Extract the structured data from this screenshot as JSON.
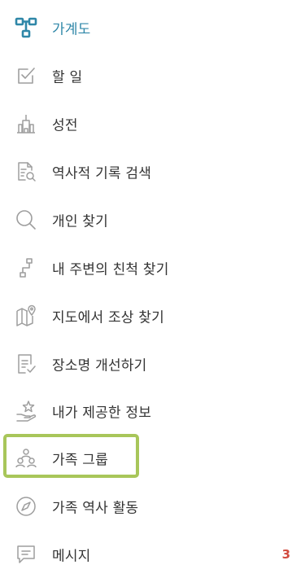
{
  "menu": {
    "items": [
      {
        "label": "가계도",
        "icon": "tree-icon",
        "active": true,
        "badge": ""
      },
      {
        "label": "할 일",
        "icon": "checklist-icon",
        "active": false,
        "badge": ""
      },
      {
        "label": "성전",
        "icon": "temple-icon",
        "active": false,
        "badge": ""
      },
      {
        "label": "역사적 기록 검색",
        "icon": "records-search-icon",
        "active": false,
        "badge": ""
      },
      {
        "label": "개인 찾기",
        "icon": "search-icon",
        "active": false,
        "badge": ""
      },
      {
        "label": "내 주변의 친척 찾기",
        "icon": "relatives-around-me-icon",
        "active": false,
        "badge": ""
      },
      {
        "label": "지도에서 조상 찾기",
        "icon": "map-pin-icon",
        "active": false,
        "badge": ""
      },
      {
        "label": "장소명 개선하기",
        "icon": "document-check-icon",
        "active": false,
        "badge": ""
      },
      {
        "label": "내가 제공한 정보",
        "icon": "hand-star-icon",
        "active": false,
        "badge": ""
      },
      {
        "label": "가족 그룹",
        "icon": "family-group-icon",
        "active": false,
        "badge": ""
      },
      {
        "label": "가족 역사 활동",
        "icon": "compass-icon",
        "active": false,
        "badge": ""
      },
      {
        "label": "메시지",
        "icon": "message-icon",
        "active": false,
        "badge": "3"
      }
    ]
  },
  "colors": {
    "accent": "#2f87a8",
    "text": "#333333",
    "icon": "#9e9e9e",
    "badge": "#d24b3f",
    "highlight": "#a8c65a"
  }
}
